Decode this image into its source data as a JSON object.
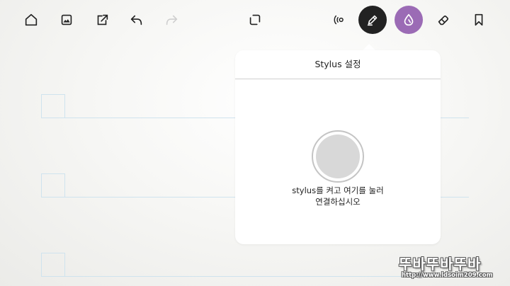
{
  "toolbar": {
    "icons": [
      "home-icon",
      "image-icon",
      "share-icon",
      "undo-icon",
      "redo-icon",
      "crop-select-icon",
      "stylus-connect-icon",
      "pen-icon",
      "color-drop-icon",
      "eraser-icon",
      "bookmark-icon"
    ],
    "pen_color": "#222222",
    "active_color": "#9b6bb5"
  },
  "popover": {
    "title": "Stylus 설정",
    "message_line1": "stylus를 켜고 여기를 눌러",
    "message_line2": "연결하십시오"
  },
  "watermark": {
    "logo": "뚜바뚜바뚜바",
    "url": "http://www.ldsoim209.com"
  }
}
